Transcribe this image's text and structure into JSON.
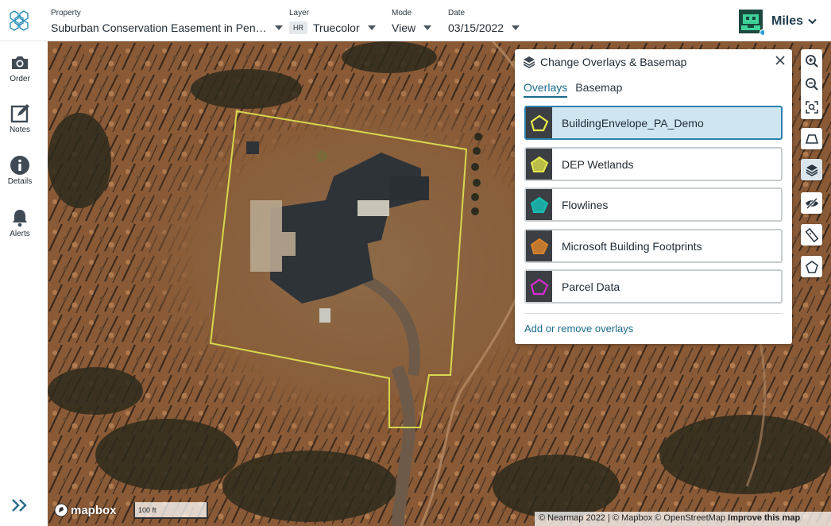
{
  "header": {
    "property_label": "Property",
    "property_value": "Suburban Conservation Easement in Pen…",
    "layer_label": "Layer",
    "layer_badge": "HR",
    "layer_value": "Truecolor",
    "mode_label": "Mode",
    "mode_value": "View",
    "date_label": "Date",
    "date_value": "03/15/2022",
    "user_name": "Miles"
  },
  "sidebar": {
    "items": [
      {
        "label": "Order",
        "icon": "camera-icon"
      },
      {
        "label": "Notes",
        "icon": "notes-icon"
      },
      {
        "label": "Details",
        "icon": "info-icon"
      },
      {
        "label": "Alerts",
        "icon": "bell-icon"
      }
    ],
    "expand_icon": "double-chevron-right-icon"
  },
  "overlay_panel": {
    "title": "Change Overlays & Basemap",
    "tabs": [
      {
        "label": "Overlays",
        "active": true
      },
      {
        "label": "Basemap",
        "active": false
      }
    ],
    "layers": [
      {
        "label": "BuildingEnvelope_PA_Demo",
        "color": "#e6e84a",
        "selected": true
      },
      {
        "label": "DEP Wetlands",
        "color": "#e6e84a",
        "selected": false
      },
      {
        "label": "Flowlines",
        "color": "#16bdb3",
        "selected": false
      },
      {
        "label": "Microsoft Building Footprints",
        "color": "#d9822b",
        "selected": false
      },
      {
        "label": "Parcel Data",
        "color": "#d82bd0",
        "selected": false
      }
    ],
    "footer_link": "Add or remove overlays"
  },
  "map": {
    "scale_label": "100 ft",
    "logo_text": "mapbox",
    "attribution": "© Nearmap 2022 | © Mapbox © OpenStreetMap",
    "improve_link": "Improve this map",
    "envelope_color": "#d6d84e"
  },
  "colors": {
    "accent": "#1a6b8a",
    "selected_bg": "#cfe6f1",
    "selected_border": "#2b82b1"
  }
}
